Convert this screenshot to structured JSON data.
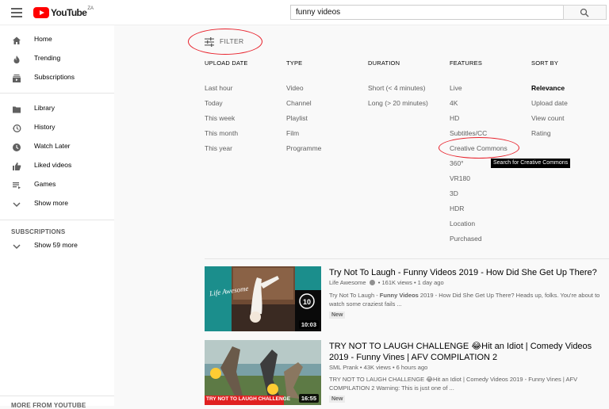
{
  "header": {
    "logo_text": "YouTube",
    "region": "ZA",
    "search_value": "funny videos"
  },
  "sidebar": {
    "items": [
      {
        "label": "Home",
        "icon": "home-icon"
      },
      {
        "label": "Trending",
        "icon": "trending-icon"
      },
      {
        "label": "Subscriptions",
        "icon": "subscriptions-icon"
      },
      {
        "label": "Library",
        "icon": "library-icon"
      },
      {
        "label": "History",
        "icon": "history-icon"
      },
      {
        "label": "Watch Later",
        "icon": "watch-later-icon"
      },
      {
        "label": "Liked videos",
        "icon": "thumbs-up-icon"
      },
      {
        "label": "Games",
        "icon": "playlist-icon"
      },
      {
        "label": "Show more",
        "icon": "chevron-down-icon"
      }
    ],
    "subscriptions_title": "SUBSCRIPTIONS",
    "show_more_subs": "Show 59 more",
    "more_from_title": "MORE FROM YOUTUBE"
  },
  "filter": {
    "button_label": "FILTER",
    "columns": [
      {
        "heading": "UPLOAD DATE",
        "options": [
          "Last hour",
          "Today",
          "This week",
          "This month",
          "This year"
        ]
      },
      {
        "heading": "TYPE",
        "options": [
          "Video",
          "Channel",
          "Playlist",
          "Film",
          "Programme"
        ]
      },
      {
        "heading": "DURATION",
        "options": [
          "Short (< 4 minutes)",
          "Long (> 20 minutes)"
        ]
      },
      {
        "heading": "FEATURES",
        "options": [
          "Live",
          "4K",
          "HD",
          "Subtitles/CC",
          "Creative Commons",
          "360°",
          "VR180",
          "3D",
          "HDR",
          "Location",
          "Purchased"
        ]
      },
      {
        "heading": "SORT BY",
        "options": [
          "Relevance",
          "Upload date",
          "View count",
          "Rating"
        ],
        "selected": "Relevance"
      }
    ],
    "tooltip": "Search for Creative Commons"
  },
  "results": [
    {
      "title": "Try Not To Laugh - Funny Videos 2019 - How Did She Get Up There?",
      "channel": "Life Awesome",
      "verified": true,
      "views": "161K views",
      "age": "1 day ago",
      "desc_prefix": "Try Not To Laugh - ",
      "desc_bold": "Funny Videos",
      "desc_suffix": " 2019 - How Did She Get Up There? Heads up, folks. You're about to watch some craziest fails ...",
      "badge": "New",
      "duration": "10:03",
      "thumb_text": "Life Awesome"
    },
    {
      "title": "TRY NOT TO LAUGH CHALLENGE 😂Hit an Idiot | Comedy Videos 2019 - Funny Vines | AFV COMPILATION 2",
      "channel": "SML Prank",
      "verified": false,
      "views": "43K views",
      "age": "6 hours ago",
      "desc_prefix": "TRY NOT TO LAUGH CHALLENGE 😂Hit an Idiot | Comedy Videos 2019 - Funny Vines | AFV COMPILATION 2 Warning: This is just one of ...",
      "desc_bold": "",
      "desc_suffix": "",
      "badge": "New",
      "duration": "16:55",
      "thumb_text": "TRY NOT TO LAUGH CHALLENGE"
    }
  ],
  "colors": {
    "brand_red": "#ff0000",
    "annotation_red": "#e8202a",
    "thumb1_teal": "#1a8a8a"
  }
}
